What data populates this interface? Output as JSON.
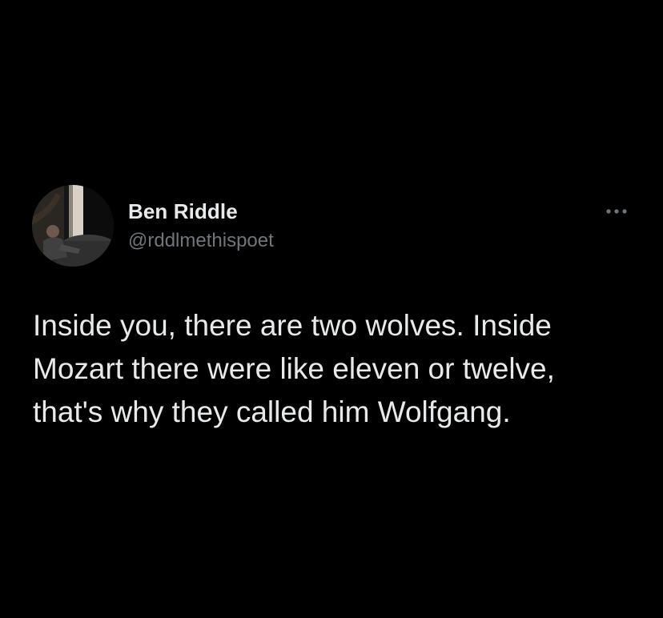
{
  "tweet": {
    "author": {
      "display_name": "Ben Riddle",
      "handle": "@rddlmethispoet",
      "avatar_icon": "profile-photo"
    },
    "more_icon": "ellipsis-icon",
    "text_lines": [
      "Inside you, there are two wolves. Inside",
      "Mozart there were like eleven or twelve,",
      "that's why they called him Wolfgang."
    ]
  },
  "colors": {
    "background": "#000000",
    "primary_text": "#e7e9ea",
    "secondary_text": "#71767b"
  }
}
